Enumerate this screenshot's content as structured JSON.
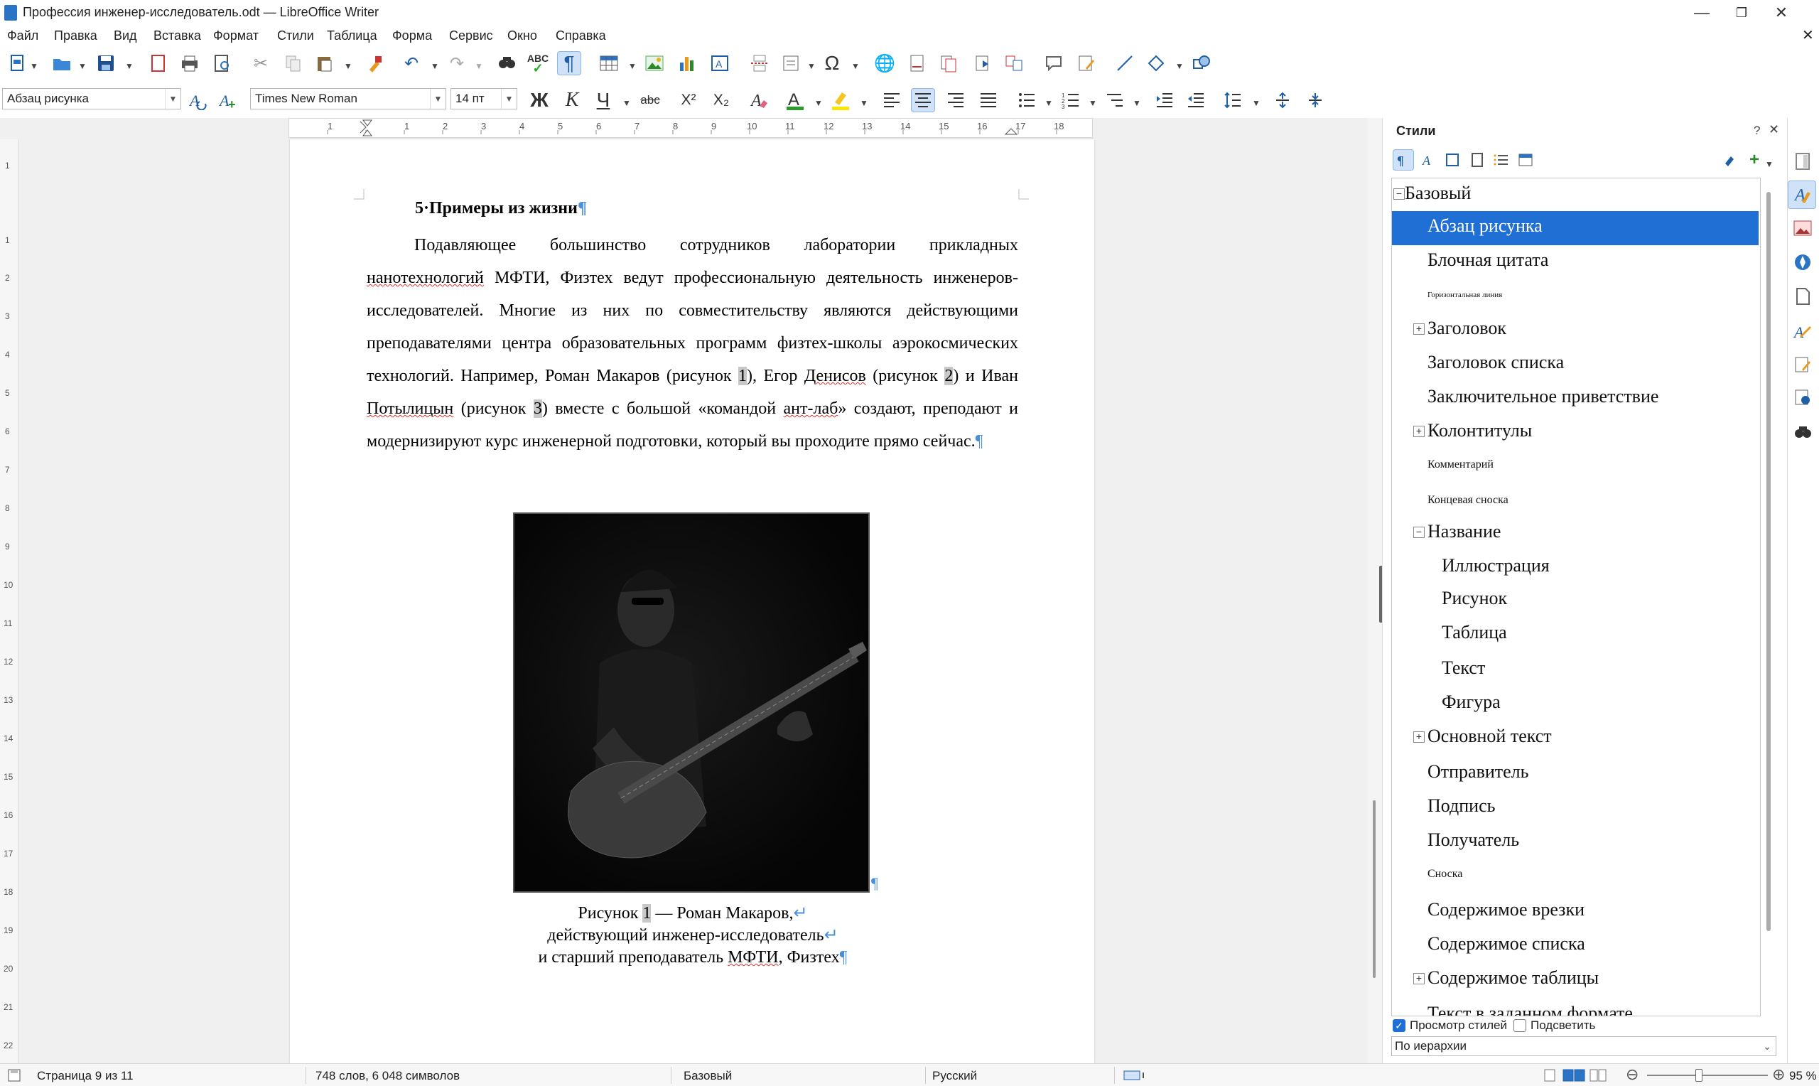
{
  "window": {
    "title": "Профессия инженер-исследователь.odt — LibreOffice Writer",
    "minimize": "—",
    "maximize": "❐",
    "close": "✕",
    "doc_close": "✕"
  },
  "menu": [
    "Файл",
    "Правка",
    "Вид",
    "Вставка",
    "Формат",
    "Стили",
    "Таблица",
    "Форма",
    "Сервис",
    "Окно",
    "Справка"
  ],
  "formatting": {
    "paragraph_style": "Абзац рисунка",
    "font_name": "Times New Roman",
    "font_size": "14 пт",
    "bold": "Ж",
    "italic": "К",
    "underline": "Ч",
    "strike": "abc",
    "superscript": "X²",
    "subscript": "X₂"
  },
  "ruler": {
    "ticks": [
      "1",
      "1",
      "2",
      "3",
      "4",
      "5",
      "6",
      "7",
      "8",
      "9",
      "10",
      "11",
      "12",
      "13",
      "14",
      "15",
      "16",
      "17",
      "18"
    ]
  },
  "vruler": {
    "ticks": [
      "1",
      "1",
      "2",
      "3",
      "4",
      "5",
      "6",
      "7",
      "8",
      "9",
      "10",
      "11",
      "12",
      "13",
      "14",
      "15",
      "16",
      "17",
      "18",
      "19",
      "20",
      "21",
      "22"
    ]
  },
  "document": {
    "heading_num": "5",
    "heading": "Примеры из жизни",
    "para_part1": "Подавляющее большинство сотрудников лаборатории прикладных ",
    "w_nano": "нанотехнологий",
    "para_part2": " МФТИ, Физтех ведут профессиональную деятельность инженеров-исследователей. Многие из них по совместительству являются действующими преподавателями центра образовательных программ физтех-школы аэрокосмических технологий. Например, Роман Макаров (рисунок ",
    "fig1": "1",
    "para_part3": "), Егор ",
    "w_denisov": "Денисов",
    "para_part4": " (рисунок ",
    "fig2": "2",
    "para_part5": ") и Иван ",
    "w_potylitsyn": "Потылицын",
    "para_part6": " (рисунок ",
    "fig3": "3",
    "para_part7": ") вместе с большой «командой ",
    "w_antlab": "ант-лаб",
    "para_part8": "» создают, преподают и модернизируют курс инженерной подготовки, который вы проходите прямо сейчас.",
    "pilcrow": "¶",
    "break_mark": "↵",
    "caption_line1_pre": "Рисунок ",
    "caption_num": "1",
    "caption_line1_post": " — Роман Макаров,",
    "caption_line2": "действующий инженер-исследователь",
    "caption_line3_pre": "и старший преподаватель ",
    "caption_mipt": "МФТИ",
    "caption_line3_post": ", Физтех"
  },
  "sidebar": {
    "title": "Стили",
    "help": "?",
    "close": "✕",
    "menu": "☰",
    "styles": [
      {
        "label": "Базовый",
        "level": 0,
        "expander": "−",
        "size": "big"
      },
      {
        "label": "Абзац рисунка",
        "level": 1,
        "selected": true,
        "size": "big"
      },
      {
        "label": "Блочная цитата",
        "level": 1,
        "size": "big"
      },
      {
        "label": "Горизонтальная линия",
        "level": 1,
        "size": "tiny"
      },
      {
        "label": "Заголовок",
        "level": 1,
        "expander": "+",
        "size": "big"
      },
      {
        "label": "Заголовок списка",
        "level": 1,
        "size": "big"
      },
      {
        "label": "Заключительное приветствие",
        "level": 1,
        "size": "big"
      },
      {
        "label": "Колонтитулы",
        "level": 1,
        "expander": "+",
        "size": "big"
      },
      {
        "label": "Комментарий",
        "level": 1,
        "size": "small"
      },
      {
        "label": "Концевая сноска",
        "level": 1,
        "size": "small"
      },
      {
        "label": "Название",
        "level": 1,
        "expander": "−",
        "size": "big"
      },
      {
        "label": "Иллюстрация",
        "level": 2,
        "size": "big"
      },
      {
        "label": "Рисунок",
        "level": 2,
        "size": "big"
      },
      {
        "label": "Таблица",
        "level": 2,
        "size": "big"
      },
      {
        "label": "Текст",
        "level": 2,
        "size": "big"
      },
      {
        "label": "Фигура",
        "level": 2,
        "size": "big"
      },
      {
        "label": "Основной текст",
        "level": 1,
        "expander": "+",
        "size": "big"
      },
      {
        "label": "Отправитель",
        "level": 1,
        "size": "big"
      },
      {
        "label": "Подпись",
        "level": 1,
        "size": "big"
      },
      {
        "label": "Получатель",
        "level": 1,
        "size": "big"
      },
      {
        "label": "Сноска",
        "level": 1,
        "size": "small"
      },
      {
        "label": "Содержимое врезки",
        "level": 1,
        "size": "big"
      },
      {
        "label": "Содержимое списка",
        "level": 1,
        "size": "big"
      },
      {
        "label": "Содержимое таблицы",
        "level": 1,
        "expander": "+",
        "size": "big"
      },
      {
        "label": "Текст в заданном формате",
        "level": 1,
        "size": "big"
      }
    ],
    "preview_label": "Просмотр стилей",
    "highlight_label": "Подсветить",
    "filter_value": "По иерархии"
  },
  "status": {
    "page": "Страница 9 из 11",
    "words": "748 слов, 6 048 символов",
    "page_style": "Базовый",
    "language": "Русский",
    "zoom": "95 %"
  },
  "colors": {
    "accent": "#1f6fd4",
    "pilcrow": "#4a90d9",
    "spell": "#dd3333"
  }
}
